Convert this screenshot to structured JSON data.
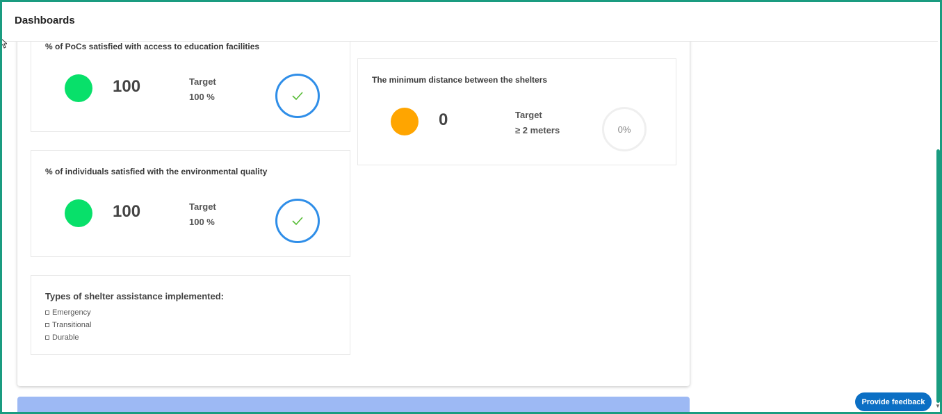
{
  "header": {
    "title": "Dashboards"
  },
  "cards": [
    {
      "title": "% of PoCs satisfied with access to education facilities",
      "status_color": "#08e06a",
      "value": "100",
      "target_label": "Target",
      "target_value": "100 %",
      "status": "achieved"
    },
    {
      "title": "% of individuals satisfied with the environmental quality",
      "status_color": "#08e06a",
      "value": "100",
      "target_label": "Target",
      "target_value": "100 %",
      "status": "achieved"
    },
    {
      "title": "The minimum distance between the shelters",
      "status_color": "#ffa500",
      "value": "0",
      "target_label": "Target",
      "target_value": "≥ 2 meters",
      "progress_text": "0%",
      "progress": 0
    }
  ],
  "shelter_types": {
    "title": "Types of shelter assistance implemented:",
    "items": [
      "Emergency",
      "Transitional",
      "Durable"
    ]
  },
  "feedback_button": "Provide feedback",
  "colors": {
    "accent": "#1a9c80",
    "ring": "#2f8ee8",
    "check": "#55bb33",
    "feedback": "#0b6fc4"
  }
}
